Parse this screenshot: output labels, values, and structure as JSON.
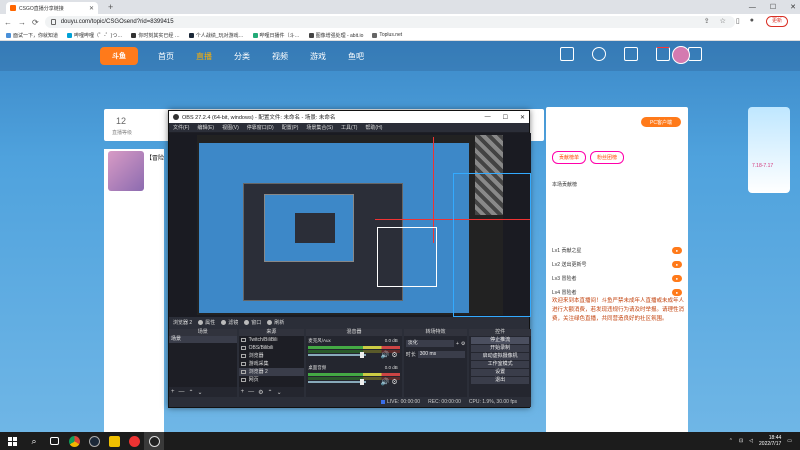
{
  "browser": {
    "tab_title": "CSGO直播分享链接",
    "url": "douyu.com/topic/CSGOsend?rid=8399415",
    "update_label": "更新",
    "bookmarks": [
      "面试一下，你就知道",
      "哔哩哔哩（゜-゜)つ…",
      "你时刻其实已经 …",
      "个人战绩_玩对游戏…",
      "哔哩日播件（斗…",
      "图像增强处理 - abit.io",
      "Toplus.net"
    ]
  },
  "site": {
    "logo": "斗鱼",
    "menu": [
      "首页",
      "直播",
      "分类",
      "视频",
      "游戏",
      "鱼吧"
    ],
    "active_menu": "直播",
    "level": "12",
    "level_sub": "直播等级",
    "anchor_name": "【冒险",
    "pc_label": "PC客户端",
    "rank_tabs": [
      "贡献榜单",
      "粉丝团榜"
    ],
    "rank_title": "本场贡献榜",
    "rank_rows": [
      "Lv1 贡献之星",
      "Lv2 送出更新号",
      "Lv3 冒险者",
      "Lv4 冒险者"
    ],
    "chat_text": "欢迎来到本直播间！斗鱼严禁未成年人直播或未成年人进行大额消费，若发现违规行为请及时举报。请理性消费，关注绿色直播，共同营造良好的社区氛围。",
    "ad_text": "7.18-7.17"
  },
  "obs": {
    "title": "OBS 27.2.4 (64-bit, windows) - 配置文件: 未命名 - 场景: 未命名",
    "menu": [
      "文件(F)",
      "编辑(E)",
      "视图(V)",
      "停靠窗口(D)",
      "配置(P)",
      "场景集合(S)",
      "工具(T)",
      "帮助(H)"
    ],
    "toolbar": {
      "source_name": "浏览器 2",
      "buttons": [
        "属性",
        "滤镜",
        "窗口",
        "刷新"
      ]
    },
    "docks": {
      "scenes": {
        "title": "场景",
        "items": [
          "场景"
        ]
      },
      "sources": {
        "title": "来源",
        "items": [
          "Twitch/BiliBili",
          "OBS/Bilibili",
          "浏览器",
          "游戏采集",
          "浏览器 2",
          "网页"
        ]
      },
      "mixer": {
        "title": "混音器",
        "channels": [
          {
            "name": "麦克风/Aux",
            "db": "0.0 dB"
          },
          {
            "name": "桌面音频",
            "db": "0.0 dB"
          }
        ]
      },
      "transitions": {
        "title": "转场特效",
        "selected": "淡化",
        "duration_label": "时长",
        "duration": "300 ms"
      },
      "controls": {
        "title": "控件",
        "buttons": [
          "停止推流",
          "开始录制",
          "启动虚拟摄像机",
          "工作室模式",
          "设置",
          "退出"
        ]
      }
    },
    "status": {
      "live": "LIVE: 00:00:00",
      "rec": "REC: 00:00:00",
      "cpu": "CPU: 1.9%, 30.00 fps"
    }
  },
  "taskbar": {
    "time": "18:44",
    "date": "2022/7/17"
  }
}
